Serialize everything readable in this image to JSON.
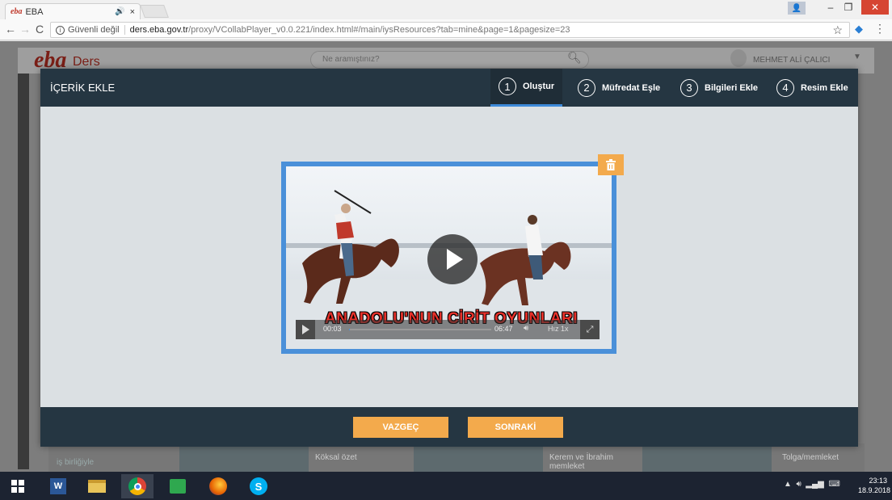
{
  "browser": {
    "tab_title": "EBA",
    "tab_logo": "eba",
    "tab_audio": "🔊",
    "tab_close": "×",
    "security_label": "Güvenli değil",
    "url_host": "ders.eba.gov.tr",
    "url_path": "/proxy/VCollabPlayer_v0.0.221/index.html#/main/iysResources?tab=mine&page=1&pagesize=23"
  },
  "eba": {
    "logo": "eba",
    "section": "Ders",
    "search_placeholder": "Ne aramıştınız?",
    "user_name": "MEHMET ALİ ÇALICI",
    "thumb_labels": [
      "Köksal özet",
      "Kerem ve İbrahim memleket",
      "Tolga/memleket"
    ],
    "side_label": "iş birliğiyle"
  },
  "modal": {
    "title": "İÇERİK EKLE",
    "steps": [
      {
        "num": "1",
        "label": "Oluştur",
        "active": true
      },
      {
        "num": "2",
        "label": "Müfredat Eşle",
        "active": false
      },
      {
        "num": "3",
        "label": "Bilgileri Ekle",
        "active": false
      },
      {
        "num": "4",
        "label": "Resim Ekle",
        "active": false
      }
    ],
    "cancel_label": "VAZGEÇ",
    "next_label": "SONRAKİ"
  },
  "video": {
    "caption": "ANADOLU'NUN CİRİT OYUNLARI",
    "current_time": "00:03",
    "duration": "06:47",
    "speed": "Hız 1x",
    "progress": 0.007
  },
  "taskbar": {
    "time": "23:13",
    "date": "18.9.2018"
  }
}
